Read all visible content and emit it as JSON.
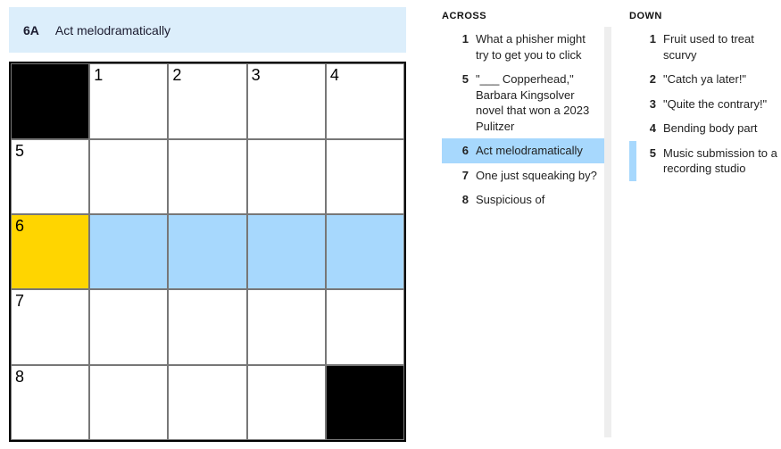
{
  "current_clue": {
    "label": "6A",
    "text": "Act melodramatically"
  },
  "grid": {
    "rows": 5,
    "cols": 5,
    "cells": [
      [
        {
          "black": true
        },
        {
          "num": "1"
        },
        {
          "num": "2"
        },
        {
          "num": "3"
        },
        {
          "num": "4"
        }
      ],
      [
        {
          "num": "5"
        },
        {},
        {},
        {},
        {}
      ],
      [
        {
          "num": "6",
          "cursor": true
        },
        {
          "hl": true
        },
        {
          "hl": true
        },
        {
          "hl": true
        },
        {
          "hl": true
        }
      ],
      [
        {
          "num": "7"
        },
        {},
        {},
        {},
        {}
      ],
      [
        {
          "num": "8"
        },
        {},
        {},
        {},
        {
          "black": true
        }
      ]
    ]
  },
  "across": {
    "heading": "ACROSS",
    "clues": [
      {
        "n": "1",
        "t": "What a phisher might try to get you to click"
      },
      {
        "n": "5",
        "t": "\"___ Copperhead,\" Barbara Kingsolver novel that won a 2023 Pulitzer"
      },
      {
        "n": "6",
        "t": "Act melodramatically",
        "active": true
      },
      {
        "n": "7",
        "t": "One just squeaking by?"
      },
      {
        "n": "8",
        "t": "Suspicious of"
      }
    ]
  },
  "down": {
    "heading": "DOWN",
    "clues": [
      {
        "n": "1",
        "t": "Fruit used to treat scurvy"
      },
      {
        "n": "2",
        "t": "\"Catch ya later!\""
      },
      {
        "n": "3",
        "t": "\"Quite the contrary!\""
      },
      {
        "n": "4",
        "t": "Bending body part"
      },
      {
        "n": "5",
        "t": "Music submission to a recording studio",
        "cross": true
      }
    ]
  }
}
